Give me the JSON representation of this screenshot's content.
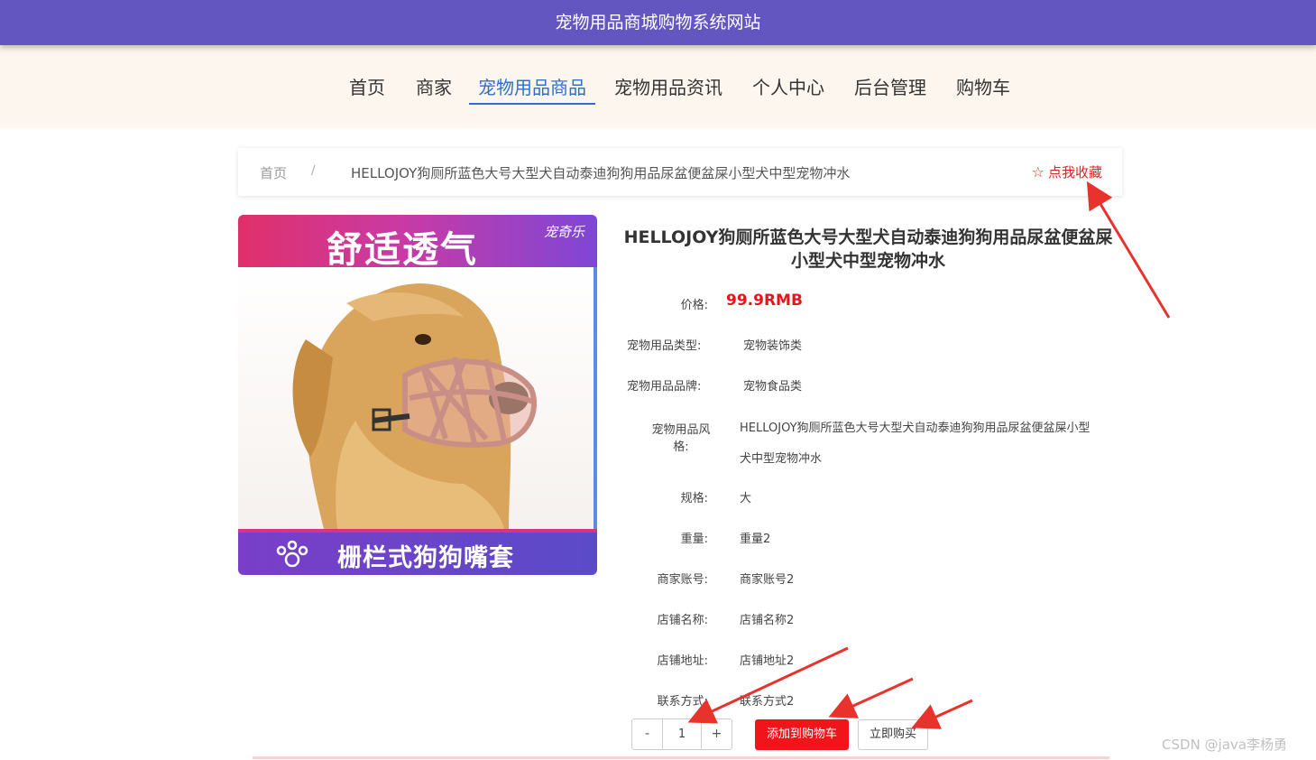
{
  "site_title": "宠物用品商城购物系统网站",
  "nav": {
    "items": [
      {
        "label": "首页"
      },
      {
        "label": "商家"
      },
      {
        "label": "宠物用品商品"
      },
      {
        "label": "宠物用品资讯"
      },
      {
        "label": "个人中心"
      },
      {
        "label": "后台管理"
      },
      {
        "label": "购物车"
      }
    ],
    "active_index": 2
  },
  "breadcrumb": {
    "home": "首页",
    "separator": "/",
    "current": "HELLOJOY狗厕所蓝色大号大型犬自动泰迪狗狗用品尿盆便盆屎小型犬中型宠物冲水",
    "favorite_label": "点我收藏"
  },
  "image": {
    "top_text": "舒适透气",
    "brand_text": "宠奇乐",
    "bottom_text": "栅栏式狗狗嘴套"
  },
  "product": {
    "title": "HELLOJOY狗厕所蓝色大号大型犬自动泰迪狗狗用品尿盆便盆屎小型犬中型宠物冲水",
    "price_label": "价格:",
    "price": "99.9RMB",
    "type_label": "宠物用品类型:",
    "type_value": "宠物装饰类",
    "brand_label": "宠物用品品牌:",
    "brand_value": "宠物食品类",
    "style_label": "宠物用品风格:",
    "style_value": "HELLOJOY狗厕所蓝色大号大型犬自动泰迪狗狗用品尿盆便盆屎小型犬中型宠物冲水",
    "spec_label": "规格:",
    "spec_value": "大",
    "weight_label": "重量:",
    "weight_value": "重量2",
    "account_label": "商家账号:",
    "account_value": "商家账号2",
    "shop_label": "店铺名称:",
    "shop_value": "店铺名称2",
    "address_label": "店铺地址:",
    "address_value": "店铺地址2",
    "contact_label": "联系方式:",
    "contact_value": "联系方式2"
  },
  "purchase": {
    "minus": "-",
    "quantity": "1",
    "plus": "+",
    "add_to_cart": "添加到购物车",
    "buy_now": "立即购买"
  },
  "watermark": "CSDN @java李杨勇",
  "colors": {
    "topbar": "#6456c0",
    "accent": "#2f6fd1",
    "price": "#e8141b",
    "cart_button": "#f2141b",
    "annotation_arrow": "#e8322c"
  }
}
